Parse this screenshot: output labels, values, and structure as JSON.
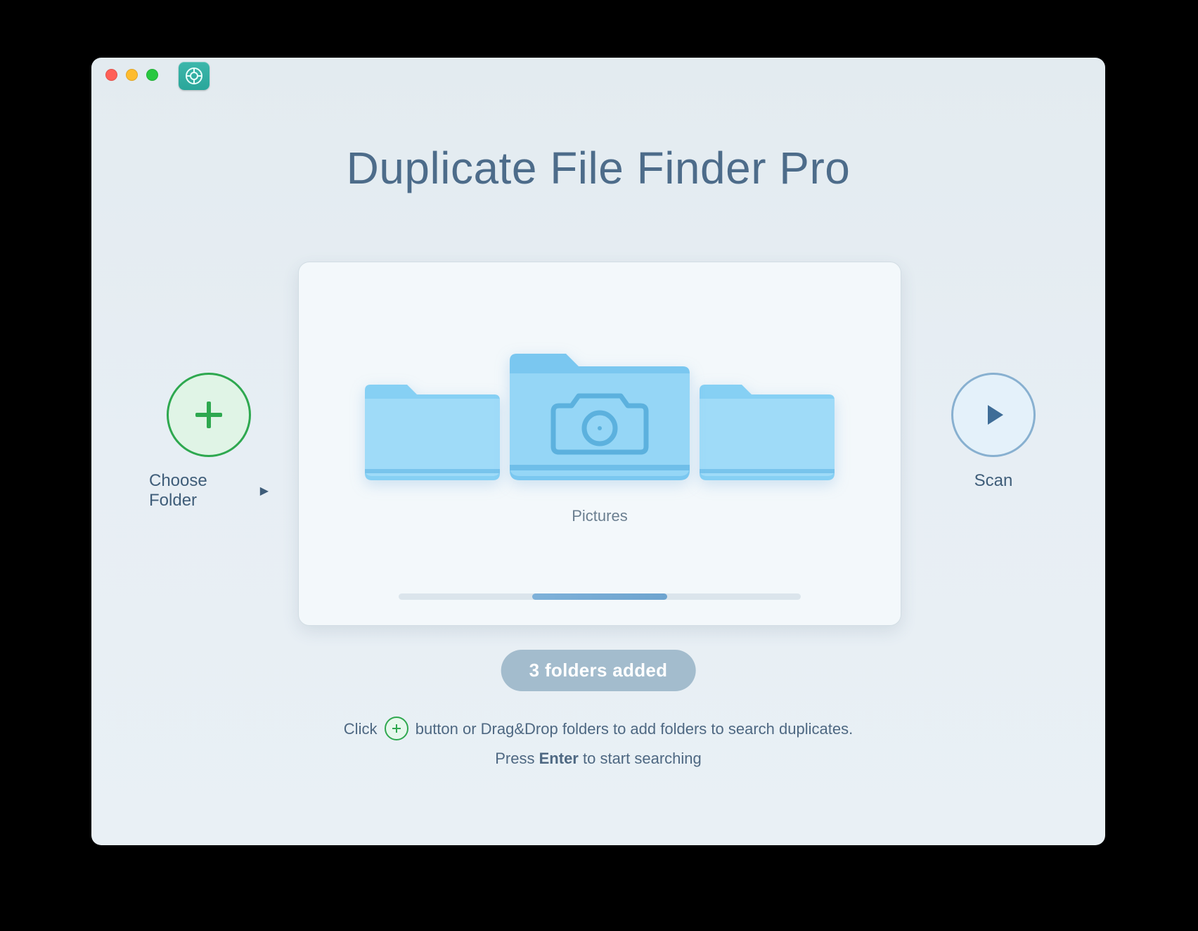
{
  "app": {
    "title": "Duplicate File Finder Pro"
  },
  "buttons": {
    "choose_folder_label": "Choose Folder",
    "scan_label": "Scan"
  },
  "carousel": {
    "selected_folder_label": "Pictures",
    "folders_added_text": "3 folders added"
  },
  "footer": {
    "line1_before": "Click",
    "line1_after": "button or Drag&Drop folders to add folders to search duplicates.",
    "line2_before": "Press",
    "line2_bold": "Enter",
    "line2_after": "to start searching"
  },
  "icons": {
    "close": "close-icon",
    "minimize": "minimize-icon",
    "zoom": "zoom-icon",
    "help": "help-icon",
    "plus": "plus-icon",
    "play": "play-icon",
    "folder": "folder-icon",
    "camera": "camera-icon",
    "chevron_right": "chevron-right-icon"
  },
  "colors": {
    "accent_green": "#2ea84f",
    "accent_blue": "#4a76a0",
    "folder_blue": "#7ec8f2"
  }
}
